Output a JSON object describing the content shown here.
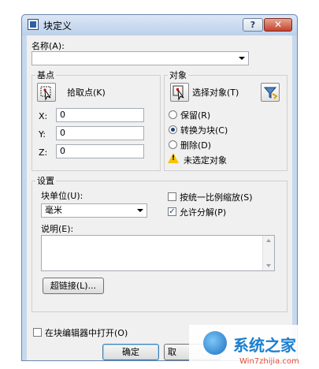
{
  "window": {
    "title": "块定义",
    "help_label": "?",
    "close_label": "✕"
  },
  "name": {
    "label": "名称(A):",
    "value": ""
  },
  "base_point": {
    "legend": "基点",
    "pick_label": "拾取点(K)",
    "x_label": "X:",
    "x_value": "0",
    "y_label": "Y:",
    "y_value": "0",
    "z_label": "Z:",
    "z_value": "0"
  },
  "objects": {
    "legend": "对象",
    "select_label": "选择对象(T)",
    "options": [
      {
        "label": "保留(R)",
        "selected": false
      },
      {
        "label": "转换为块(C)",
        "selected": true
      },
      {
        "label": "删除(D)",
        "selected": false
      }
    ],
    "warning": "未选定对象"
  },
  "settings": {
    "legend": "设置",
    "unit_label": "块单位(U):",
    "unit_value": "毫米",
    "scale_uniform": {
      "label": "按统一比例缩放(S)",
      "checked": false
    },
    "allow_explode": {
      "label": "允许分解(P)",
      "checked": true
    },
    "description_label": "说明(E):",
    "description_value": "",
    "hyperlink_label": "超链接(L)..."
  },
  "open_in_editor": {
    "label": "在块编辑器中打开(O)",
    "checked": false
  },
  "buttons": {
    "ok": "确定",
    "cancel": "取"
  },
  "watermark": {
    "text": "系统之家",
    "url": "Win7zhijia.com"
  },
  "icons": [
    "app-icon",
    "help-icon",
    "close-icon",
    "pick-point-icon",
    "select-objects-icon",
    "quick-select-icon",
    "warning-icon"
  ]
}
